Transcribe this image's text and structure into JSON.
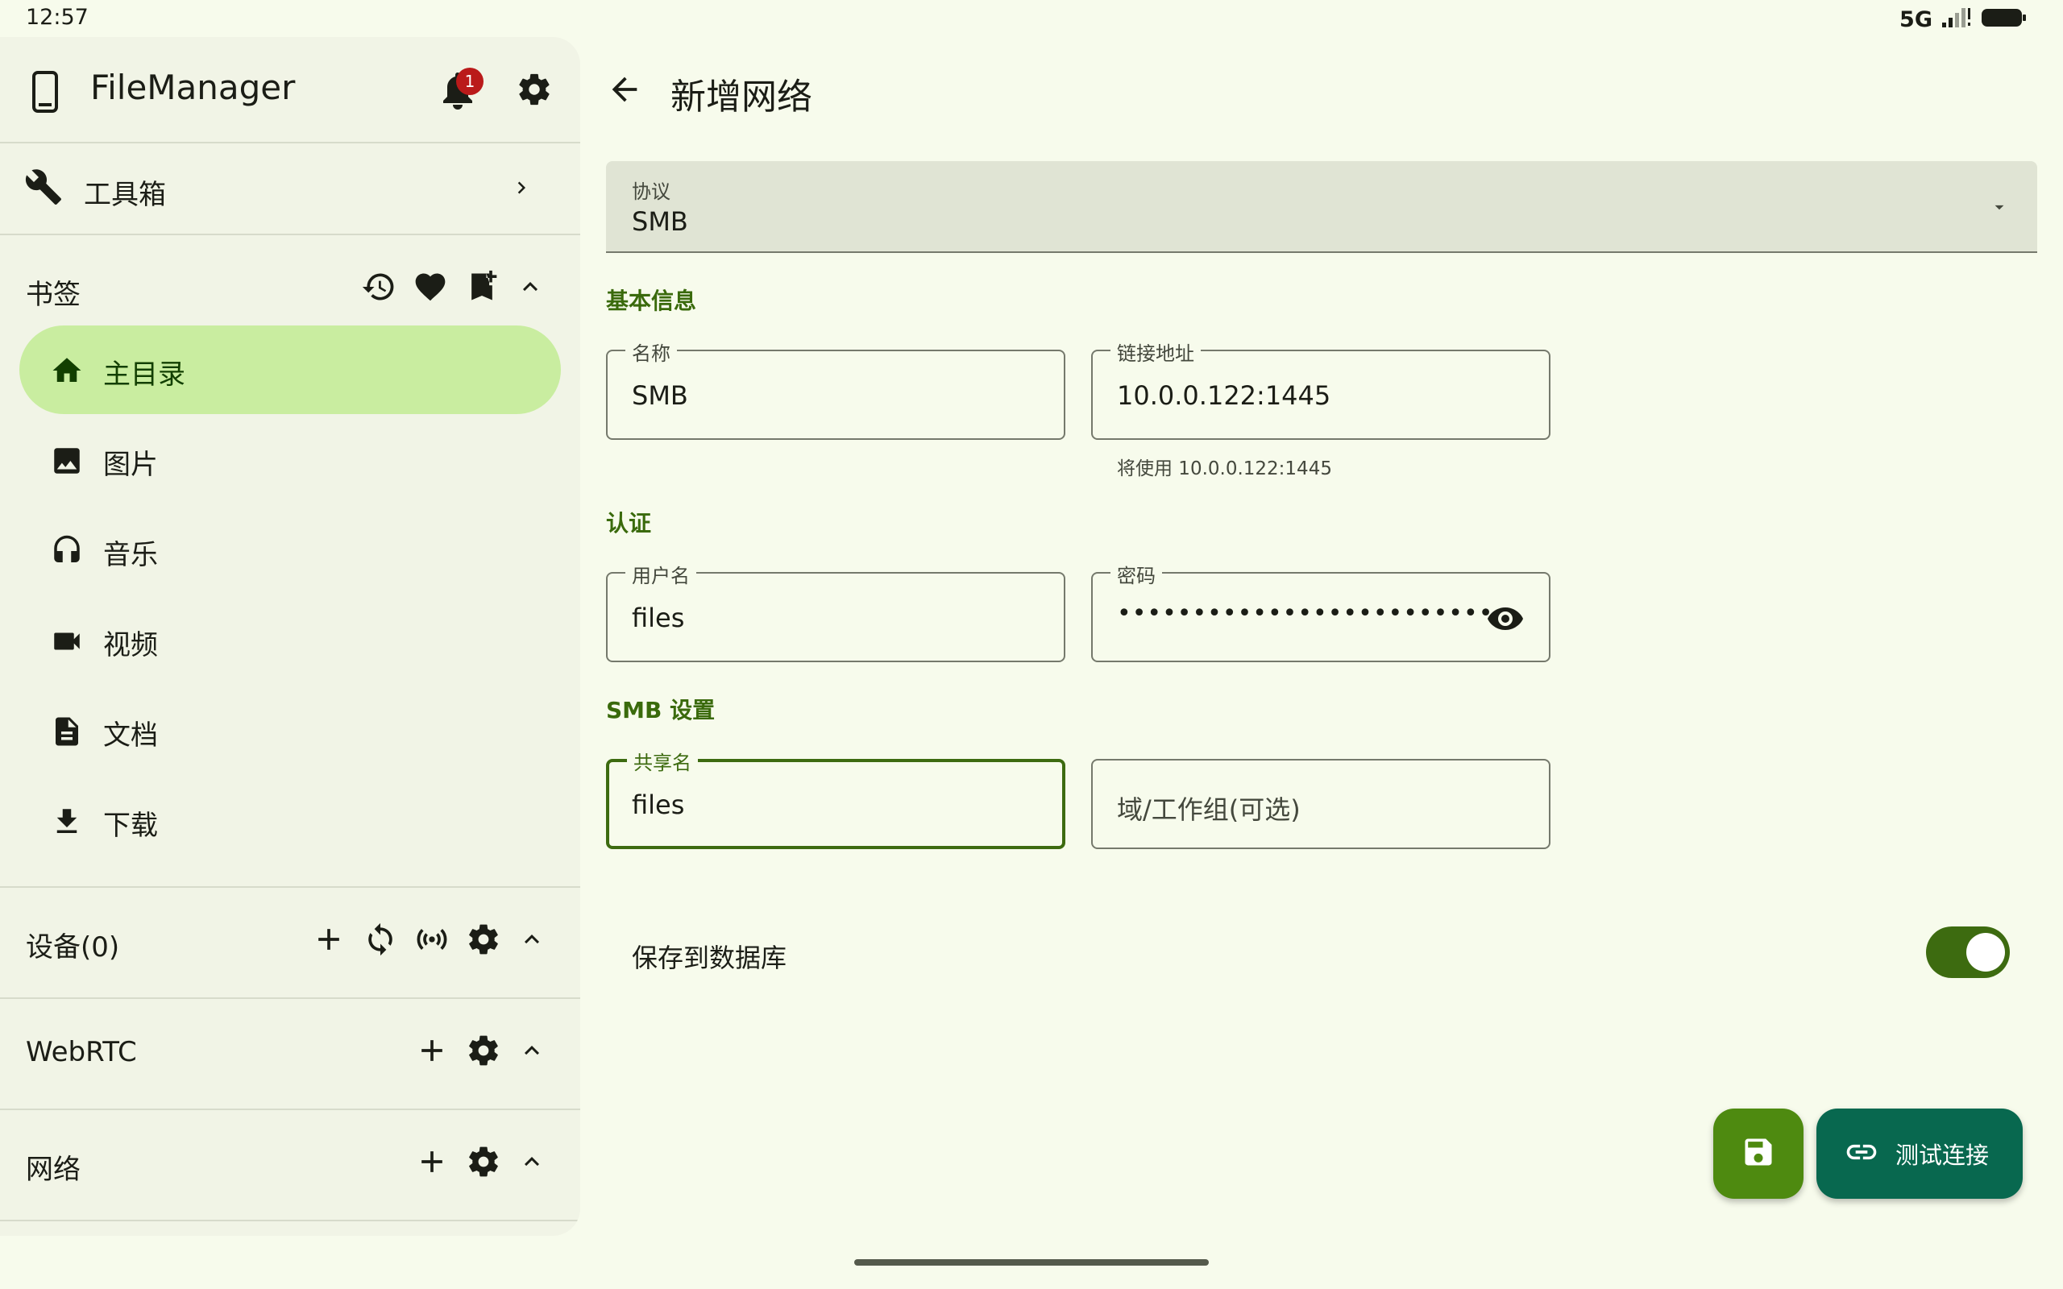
{
  "status_bar": {
    "time": "12:57",
    "network": "5G"
  },
  "drawer": {
    "app_title": "FileManager",
    "notification_count": "1",
    "toolbox_label": "工具箱",
    "bookmarks": {
      "title": "书签",
      "items": [
        {
          "label": "主目录",
          "icon": "home-icon",
          "active": true
        },
        {
          "label": "图片",
          "icon": "image-icon"
        },
        {
          "label": "音乐",
          "icon": "headphones-icon"
        },
        {
          "label": "视频",
          "icon": "video-camera-icon"
        },
        {
          "label": "文档",
          "icon": "document-icon"
        },
        {
          "label": "下载",
          "icon": "download-icon"
        }
      ]
    },
    "devices_title": "设备(0)",
    "webrtc_title": "WebRTC",
    "network_title": "网络"
  },
  "main": {
    "title": "新增网络",
    "protocol": {
      "label": "协议",
      "value": "SMB"
    },
    "basic_info": {
      "title": "基本信息",
      "name": {
        "label": "名称",
        "value": "SMB"
      },
      "address": {
        "label": "链接地址",
        "value": "10.0.0.122:1445",
        "helper": "将使用 10.0.0.122:1445"
      }
    },
    "auth": {
      "title": "认证",
      "username": {
        "label": "用户名",
        "value": "files"
      },
      "password": {
        "label": "密码",
        "masked": "•••••••••••••••••••••••••"
      }
    },
    "smb_settings": {
      "title": "SMB 设置",
      "share": {
        "label": "共享名",
        "value": "files"
      },
      "domain": {
        "placeholder": "域/工作组(可选)"
      }
    },
    "save_to_db": {
      "label": "保存到数据库",
      "enabled": true
    },
    "test_button_label": "测试连接"
  },
  "colors": {
    "background": "#f7fbec",
    "drawer_background": "#f1f4e6",
    "active_item": "#c9eda0",
    "primary": "#3d6b10",
    "save_fab": "#4e8a10",
    "test_fab": "#08684f",
    "badge": "#ba1a1a"
  }
}
